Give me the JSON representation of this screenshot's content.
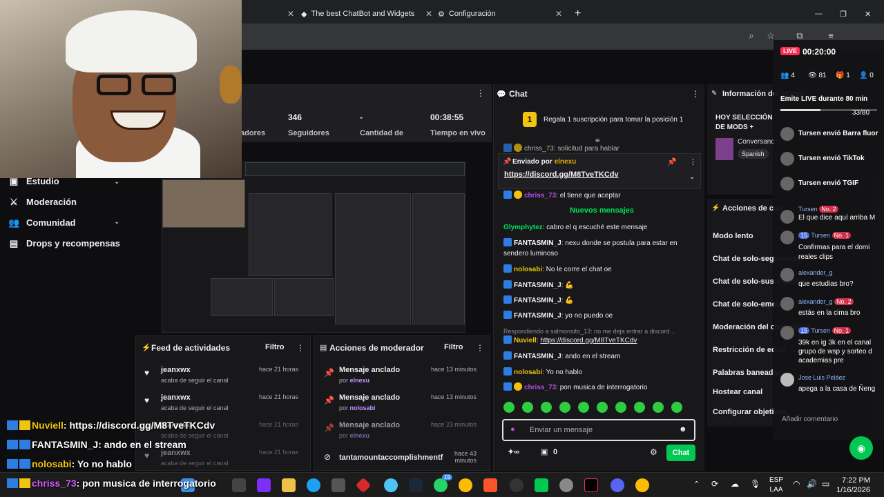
{
  "browser": {
    "tabs": [
      {
        "label": "The best ChatBot and Widgets"
      },
      {
        "label": "Configuración"
      }
    ]
  },
  "stats": {
    "followers_value": "346",
    "followers_label": "Seguidores",
    "amount_value": "-",
    "amount_label": "Cantidad de",
    "live_value": "00:38:55",
    "live_label": "Tiempo en vivo",
    "partial_label": "adores"
  },
  "nav": {
    "items": [
      {
        "label": "Estudio"
      },
      {
        "label": "Moderación"
      },
      {
        "label": "Comunidad"
      },
      {
        "label": "Drops y recompensas"
      }
    ]
  },
  "feed": {
    "title": "Feed de actividades",
    "filter": "Filtro",
    "rows": [
      {
        "name": "jeanxwx",
        "sub": "acaba de seguir el canal",
        "time": "hace 21 horas"
      },
      {
        "name": "jeanxwx",
        "sub": "acaba de seguir el canal",
        "time": "hace 21 horas"
      },
      {
        "name": "jeanxwx",
        "sub": "acaba de seguir el canal",
        "time": "hace 21 horas"
      },
      {
        "name": "jeanxwx",
        "sub": "acaba de seguir el canal",
        "time": "hace 21 horas"
      }
    ]
  },
  "modactions": {
    "title": "Acciones de moderador",
    "filter": "Filtro",
    "rows": [
      {
        "name": "Mensaje anclado",
        "by": "por",
        "user": "elnexu",
        "time": "hace 13 minutos"
      },
      {
        "name": "Mensaje anclado",
        "by": "por",
        "user": "nolosabi",
        "time": "hace 13 minutos"
      },
      {
        "name": "Mensaje anclado",
        "by": "por",
        "user": "elnexu",
        "time": "hace 23 minutos"
      },
      {
        "name": "tantamountaccomplishmentf",
        "by": "",
        "user": "",
        "time": "hace 43 minutos"
      }
    ]
  },
  "chat": {
    "title": "Chat",
    "gift_banner": "Regala 1 suscripción para tomar la posición 1",
    "gift_num": "1",
    "top_partial": "chriss_73: solicitud para hablar",
    "pinned_label": "Enviado por",
    "pinned_user": "elnexu",
    "pinned_link": "https://discord.gg/M8TveTKCdv",
    "new_messages": "Nuevos mensajes",
    "reply_hint": "Respondiendo a salmonsito_13: no me deja entrar a discord...",
    "messages": [
      {
        "user": "chriss_73",
        "text": ": el tiene que aceptar"
      },
      {
        "user": "Glymphytez",
        "text": ": cabro el q escuché este mensaje"
      },
      {
        "user": "FANTASMIN_J",
        "text": ": nexu donde se postula para estar en sendero luminoso"
      },
      {
        "user": "nolosabi",
        "text": ": No le corre el chat oe"
      },
      {
        "user": "FANTASMIN_J",
        "text": ":"
      },
      {
        "user": "FANTASMIN_J",
        "text": ":"
      },
      {
        "user": "FANTASMIN_J",
        "text": ": yo no puedo oe"
      },
      {
        "user": "Nuviell",
        "text": "https://discord.gg/M8TveTKCdv"
      },
      {
        "user": "FANTASMIN_J",
        "text": ": ando en el stream"
      },
      {
        "user": "nolosabi",
        "text": ": Yo no hablo"
      },
      {
        "user": "chriss_73",
        "text": ": pon musica de interrogatorio"
      }
    ],
    "input_placeholder": "Enviar un mensaje",
    "points": "0",
    "send_label": "Chat"
  },
  "info": {
    "title": "Información del stream",
    "stream_title": "HOY SELECCIÓN DE MODS + ¿SALE SU TIMBITA?",
    "category": "Conversand",
    "language": "Spanish"
  },
  "actions": {
    "title": "Acciones de can",
    "items": [
      "Modo lento",
      "Chat de solo-seguidores",
      "Chat de solo-suscriptores",
      "Chat de solo-emotes",
      "Moderación del chat con IA",
      "Restricción de edad",
      "Palabras baneadas",
      "Hostear canal",
      "Configurar objetivos"
    ]
  },
  "live": {
    "badge": "LIVE",
    "timer": "00:20:00",
    "viewers": "4",
    "views": "81",
    "gifts": "1",
    "follows": "0",
    "goal_text": "Emite LIVE durante 80 min",
    "goal_progress": "33/80",
    "goal_fraction": 0.4125,
    "events": [
      {
        "user": "Tursen",
        "text": "envió Barra fluor"
      },
      {
        "user": "Tursen",
        "text": "envió TikTok"
      },
      {
        "user": "Tursen",
        "text": "envió TGIF"
      }
    ],
    "comments": [
      {
        "user": "Tursen",
        "badge": "No. 2",
        "text": "El que dice aquí arriba M"
      },
      {
        "user": "Tursen",
        "level": "15",
        "badge": "No. 1",
        "text": "Confirmas para el domi reales clips"
      },
      {
        "user": "alexander_g",
        "text": "que estudias bro?"
      },
      {
        "user": "alexander_g",
        "badge": "No. 2",
        "text": "estás en la cima bro"
      },
      {
        "user": "Tursen",
        "level": "15",
        "badge": "No. 1",
        "text": "39k en ig 3k en el canal grupo de wsp y sorteo d academias pre"
      },
      {
        "user": "Jose Luis Peláez",
        "text": "apega a la casa de Ñeng"
      }
    ],
    "add_comment": "Añadir comentario"
  },
  "overlay": {
    "lines": [
      {
        "user": "Nuviell",
        "text": ": https://discord.gg/M8TveTKCdv"
      },
      {
        "user": "FANTASMIN_J",
        "text": ": ando en el stream"
      },
      {
        "user": "nolosabi",
        "text": ": Yo no hablo"
      },
      {
        "user": "chriss_73",
        "text": ": pon musica de interrogatorio"
      }
    ]
  },
  "taskbar": {
    "lang1": "ESP",
    "lang2": "LAA",
    "time": "7:22 PM",
    "date": "1/16/2026",
    "whatsapp_badge": "19"
  },
  "colors": {
    "accent_green": "#00c853",
    "live_red": "#fe2c55",
    "badge_blue": "#2e7de2"
  }
}
